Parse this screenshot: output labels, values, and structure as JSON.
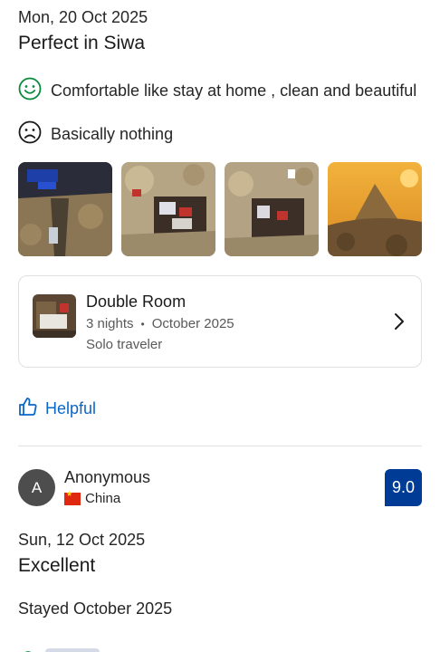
{
  "review1": {
    "date": "Mon, 20 Oct 2025",
    "title": "Perfect in Siwa",
    "positive": "Comfortable like stay at home , clean and beautiful",
    "negative": "Basically nothing",
    "positive_icon": "smile-icon",
    "negative_icon": "frown-icon",
    "room": {
      "name": "Double Room",
      "nights": "3 nights",
      "month": "October 2025",
      "traveler": "Solo traveler"
    },
    "helpful_label": "Helpful"
  },
  "review2": {
    "reviewer": "Anonymous",
    "avatar_initial": "A",
    "country": "China",
    "score": "9.0",
    "date": "Sun, 12 Oct 2025",
    "title": "Excellent",
    "stayed": "Stayed October 2025"
  },
  "colors": {
    "accent_blue": "#0a67c8",
    "score_badge": "#003b95",
    "positive_green": "#0a8a3c"
  }
}
